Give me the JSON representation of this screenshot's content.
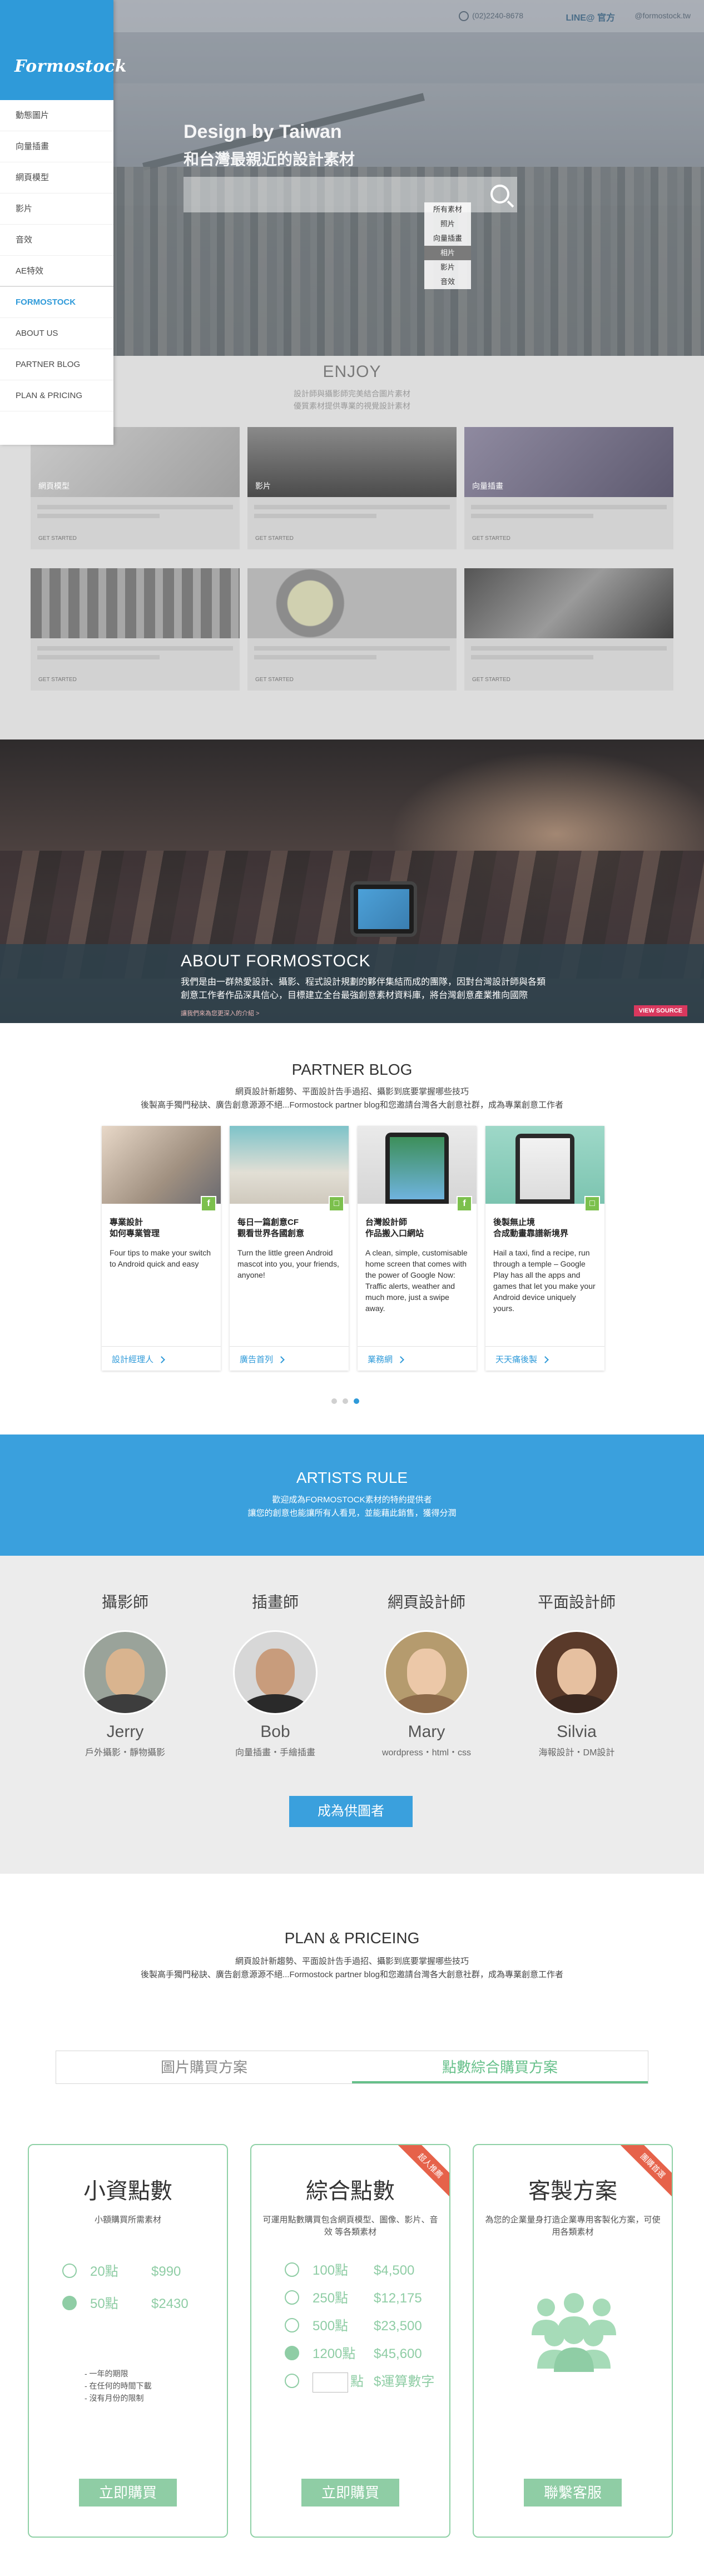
{
  "topbar": {
    "phone": "(02)2240-8678",
    "line_label": "LINE@",
    "line_text": "官方",
    "line_id": "@formostock.tw"
  },
  "side_menu": {
    "logo": "Formostock",
    "categories": [
      "動態圖片",
      "向量插畫",
      "網頁模型",
      "影片",
      "音效",
      "AE特效"
    ],
    "links": [
      "FORMOSTOCK",
      "ABOUT US",
      "PARTNER BLOG",
      "PLAN & PRICING"
    ]
  },
  "hero": {
    "title_en": "Design by Taiwan",
    "title_zh": "和台灣最親近的設計素材",
    "search_placeholder": "",
    "category_options": [
      "所有素材",
      "照片",
      "向量插畫",
      "相片",
      "影片",
      "音效"
    ],
    "category_selected_index": 3
  },
  "enjoy": {
    "title": "ENJOY",
    "sub1": "設計師與攝影師完美結合圖片素材",
    "sub2": "優質素材提供專業的視覺設計素材",
    "cards": [
      {
        "label": "網頁模型",
        "cta": "GET STARTED"
      },
      {
        "label": "影片",
        "cta": "GET STARTED"
      },
      {
        "label": "向量插畫",
        "cta": "GET STARTED"
      },
      {
        "label": "",
        "cta": "GET STARTED"
      },
      {
        "label": "",
        "cta": "GET STARTED"
      },
      {
        "label": "",
        "cta": "GET STARTED"
      }
    ]
  },
  "about": {
    "title": "ABOUT FORMOSTOCK",
    "p1": "我們是由一群熱愛設計、攝影、程式設計規劃的夥伴集結而成的團隊，因對台灣設計師與各類",
    "p2": "創意工作者作品深具信心，目標建立全台最強創意素材資料庫，將台灣創意產業推向國際",
    "link": "讓我們來為您更深入的介紹 >",
    "button": "VIEW SOURCE"
  },
  "blog": {
    "title": "PARTNER BLOG",
    "sub1": "網頁設計新趨勢、平面設計告手過招、攝影到底要掌握哪些技巧",
    "sub2": "後製高手獨門秘訣、廣告創意源源不絕...Formostock partner blog和您邀請台灣各大創意社群，成為專業創意工作者",
    "cards": [
      {
        "title": "專業設計\n如何專業管理",
        "text": "Four tips to make your switch to Android quick and easy",
        "author": "設計經理人",
        "badge": "f"
      },
      {
        "title": "每日一篇創意CF\n觀看世界各國創意",
        "text": "Turn the little green Android mascot into you, your friends, anyone!",
        "author": "廣告首列",
        "badge": "□"
      },
      {
        "title": "台灣設計師\n作品搬入口網站",
        "text": "A clean, simple, customisable home screen that comes with the power of Google Now: Traffic alerts, weather and much more, just a swipe away.",
        "author": "業務網",
        "badge": "f"
      },
      {
        "title": "後製無止境\n合成動畫靠譜新境界",
        "text": "Hail a taxi, find a recipe, run through a temple – Google Play has all the apps and games that let you make your Android device uniquely yours.",
        "author": "天天痛後製",
        "badge": "□"
      }
    ],
    "pages": 3,
    "active_page": 2
  },
  "artists": {
    "title": "ARTISTS RULE",
    "sub1": "歡迎成為FORMOSTOCK素材的特約提供者",
    "sub2": "讓您的創意也能讓所有人看見，並能藉此銷售，獲得分潤",
    "people": [
      {
        "role": "攝影師",
        "name": "Jerry",
        "skills": "戶外攝影・靜物攝影"
      },
      {
        "role": "插畫師",
        "name": "Bob",
        "skills": "向量插畫・手繪插畫"
      },
      {
        "role": "網頁設計師",
        "name": "Mary",
        "skills": "wordpress・html・css"
      },
      {
        "role": "平面設計師",
        "name": "Silvia",
        "skills": "海報設計・DM設計"
      }
    ],
    "cta": "成為供圖者"
  },
  "plans": {
    "title": "PLAN & PRICEING",
    "sub1": "網頁設計新趨勢、平面設計告手過招、攝影到底要掌握哪些技巧",
    "sub2": "後製高手獨門秘訣、廣告創意源源不絕...Formostock partner blog和您邀請台灣各大創意社群，成為專業創意工作者",
    "tabs": [
      "圖片購買方案",
      "點數綜合購買方案"
    ],
    "active_tab": 1,
    "cards": [
      {
        "title": "小資點數",
        "sub": "小額購買所需素材",
        "options": [
          {
            "points": "20點",
            "price": "$990",
            "checked": false
          },
          {
            "points": "50點",
            "price": "$2430",
            "checked": true
          }
        ],
        "notes": [
          "- 一年的期限",
          "- 在任何的時間下載",
          "- 沒有月份的限制"
        ],
        "button": "立即購買"
      },
      {
        "title": "綜合點數",
        "sub": "可運用點數購買包含網頁模型、圖像、影片、音效 等各類素材",
        "ribbon": "超人推薦",
        "options": [
          {
            "points": "100點",
            "price": "$4,500",
            "checked": false
          },
          {
            "points": "250點",
            "price": "$12,175",
            "checked": false
          },
          {
            "points": "500點",
            "price": "$23,500",
            "checked": false
          },
          {
            "points": "1200點",
            "price": "$45,600",
            "checked": true
          },
          {
            "points": "點",
            "price": "$運算數字",
            "checked": false,
            "custom": true
          }
        ],
        "button": "立即購買"
      },
      {
        "title": "客製方案",
        "sub": "為您的企業量身打造企業專用客製化方案，可使用各類素材",
        "ribbon": "團購首選",
        "button": "聯繫客服"
      }
    ]
  },
  "colors": {
    "brand_blue": "#2f9ad9",
    "accent_green": "#8fcda5",
    "ribbon_red": "#e6624a",
    "about_button": "#d9385e"
  }
}
